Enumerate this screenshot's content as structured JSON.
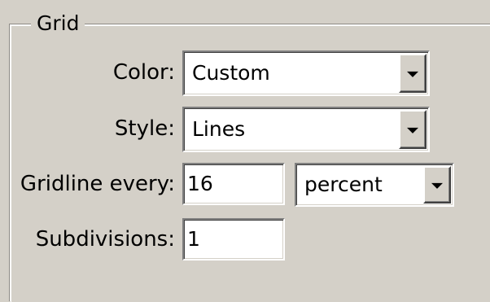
{
  "grid_group": {
    "title": "Grid"
  },
  "color": {
    "label": "Color:",
    "value": "Custom"
  },
  "style": {
    "label": "Style:",
    "value": "Lines"
  },
  "gridline": {
    "label": "Gridline every:",
    "value": "16",
    "unit": "percent"
  },
  "subdivisions": {
    "label": "Subdivisions:",
    "value": "1"
  },
  "icons": {
    "dropdown": "chevron-down-icon"
  }
}
